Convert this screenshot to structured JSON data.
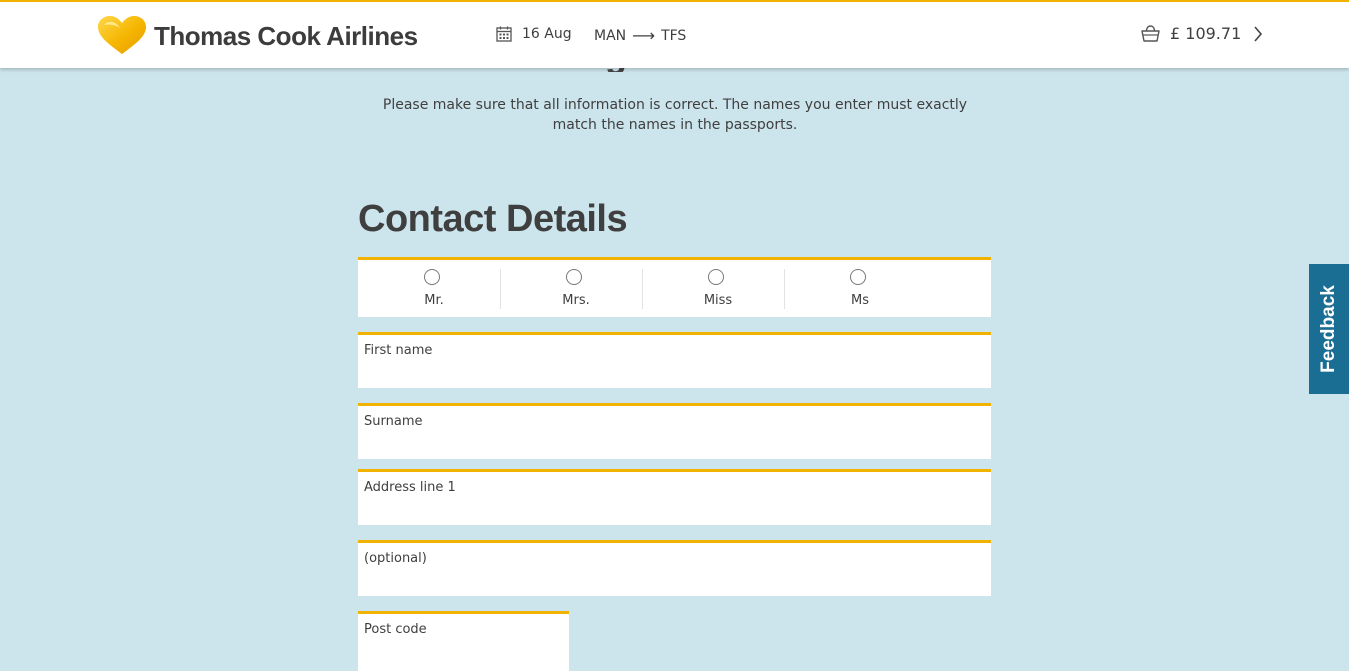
{
  "header": {
    "brand": "Thomas Cook Airlines",
    "date": "16 Aug",
    "origin": "MAN",
    "destination": "TFS",
    "basket_total": "£ 109.71"
  },
  "page": {
    "intro": "Please make sure that all information is correct. The names you enter must exactly match the names in the passports.",
    "section_title": "Contact Details"
  },
  "title_options": [
    "Mr.",
    "Mrs.",
    "Miss",
    "Ms"
  ],
  "fields": {
    "first_name": {
      "label": "First name",
      "value": ""
    },
    "surname": {
      "label": "Surname",
      "value": ""
    },
    "address1": {
      "label": "Address line 1",
      "value": ""
    },
    "address2": {
      "label": "(optional)",
      "value": ""
    },
    "postcode": {
      "label": "Post code",
      "value": ""
    }
  },
  "feedback": {
    "label": "Feedback"
  },
  "colors": {
    "accent": "#f2b300",
    "background": "#cce4ec",
    "feedback_tab": "#1a6e94",
    "text": "#3f3f3f"
  },
  "icons": [
    "heart-logo-icon",
    "calendar-icon",
    "arrow-right-icon",
    "basket-icon",
    "chevron-right-icon"
  ]
}
